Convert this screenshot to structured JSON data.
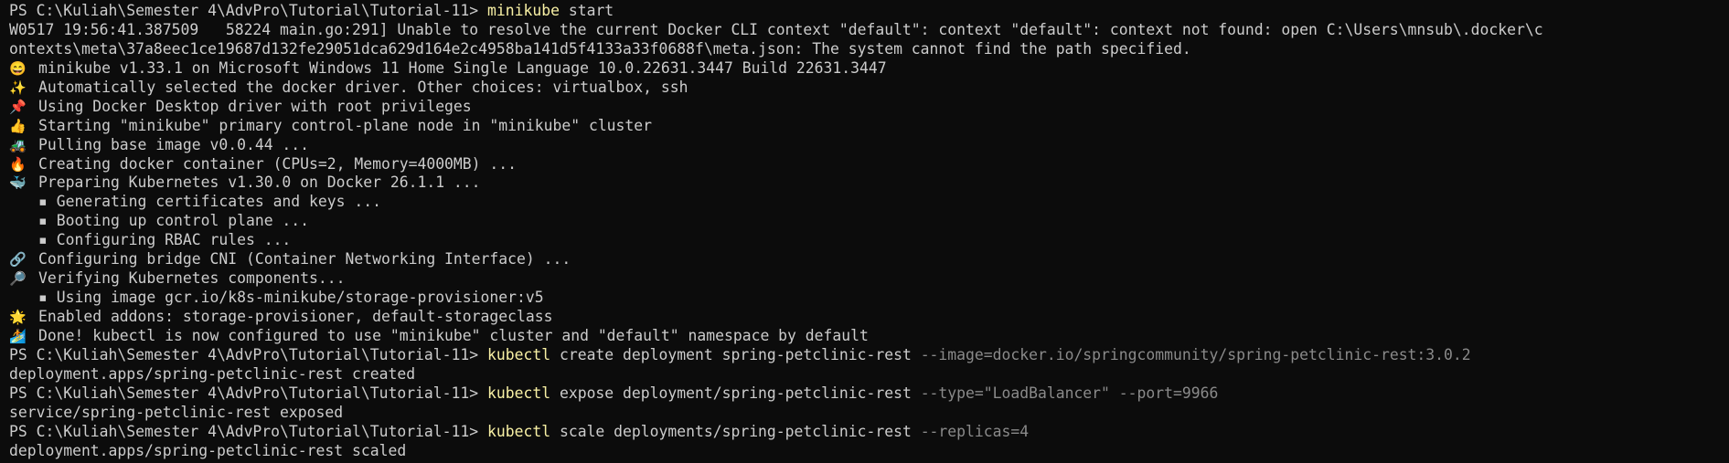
{
  "prompt": "PS C:\\Kuliah\\Semester 4\\AdvPro\\Tutorial\\Tutorial-11> ",
  "lines": [
    {
      "type": "cmd",
      "cmd": "minikube",
      "args": " start",
      "flags": ""
    },
    {
      "type": "text",
      "text": "W0517 19:56:41.387509   58224 main.go:291] Unable to resolve the current Docker CLI context \"default\": context \"default\": context not found: open C:\\Users\\mnsub\\.docker\\c"
    },
    {
      "type": "text",
      "text": "ontexts\\meta\\37a8eec1ce19687d132fe29051dca629d164e2c4958ba141d5f4133a33f0688f\\meta.json: The system cannot find the path specified."
    },
    {
      "type": "emoji",
      "icon": "😄",
      "text": "minikube v1.33.1 on Microsoft Windows 11 Home Single Language 10.0.22631.3447 Build 22631.3447"
    },
    {
      "type": "emoji",
      "icon": "✨",
      "text": "Automatically selected the docker driver. Other choices: virtualbox, ssh"
    },
    {
      "type": "emoji",
      "icon": "📌",
      "text": "Using Docker Desktop driver with root privileges"
    },
    {
      "type": "emoji",
      "icon": "👍",
      "text": "Starting \"minikube\" primary control-plane node in \"minikube\" cluster"
    },
    {
      "type": "emoji",
      "icon": "🚜",
      "text": "Pulling base image v0.0.44 ..."
    },
    {
      "type": "emoji",
      "icon": "🔥",
      "text": "Creating docker container (CPUs=2, Memory=4000MB) ..."
    },
    {
      "type": "emoji",
      "icon": "🐳",
      "text": "Preparing Kubernetes v1.30.0 on Docker 26.1.1 ..."
    },
    {
      "type": "sub",
      "text": "▪ Generating certificates and keys ..."
    },
    {
      "type": "sub",
      "text": "▪ Booting up control plane ..."
    },
    {
      "type": "sub",
      "text": "▪ Configuring RBAC rules ..."
    },
    {
      "type": "emoji",
      "icon": "🔗",
      "text": "Configuring bridge CNI (Container Networking Interface) ..."
    },
    {
      "type": "emoji",
      "icon": "🔎",
      "text": "Verifying Kubernetes components..."
    },
    {
      "type": "sub",
      "text": "▪ Using image gcr.io/k8s-minikube/storage-provisioner:v5"
    },
    {
      "type": "emoji",
      "icon": "🌟",
      "text": "Enabled addons: storage-provisioner, default-storageclass"
    },
    {
      "type": "emoji",
      "icon": "🏄",
      "text": "Done! kubectl is now configured to use \"minikube\" cluster and \"default\" namespace by default"
    },
    {
      "type": "cmd",
      "cmd": "kubectl",
      "args": " create deployment spring-petclinic-rest ",
      "flags": "--image=docker.io/springcommunity/spring-petclinic-rest:3.0.2"
    },
    {
      "type": "text",
      "text": "deployment.apps/spring-petclinic-rest created"
    },
    {
      "type": "cmd",
      "cmd": "kubectl",
      "args": " expose deployment/spring-petclinic-rest ",
      "flags": "--type=\"LoadBalancer\" --port=9966"
    },
    {
      "type": "text",
      "text": "service/spring-petclinic-rest exposed"
    },
    {
      "type": "cmd",
      "cmd": "kubectl",
      "args": " scale deployments/spring-petclinic-rest ",
      "flags": "--replicas=4"
    },
    {
      "type": "text",
      "text": "deployment.apps/spring-petclinic-rest scaled"
    }
  ]
}
